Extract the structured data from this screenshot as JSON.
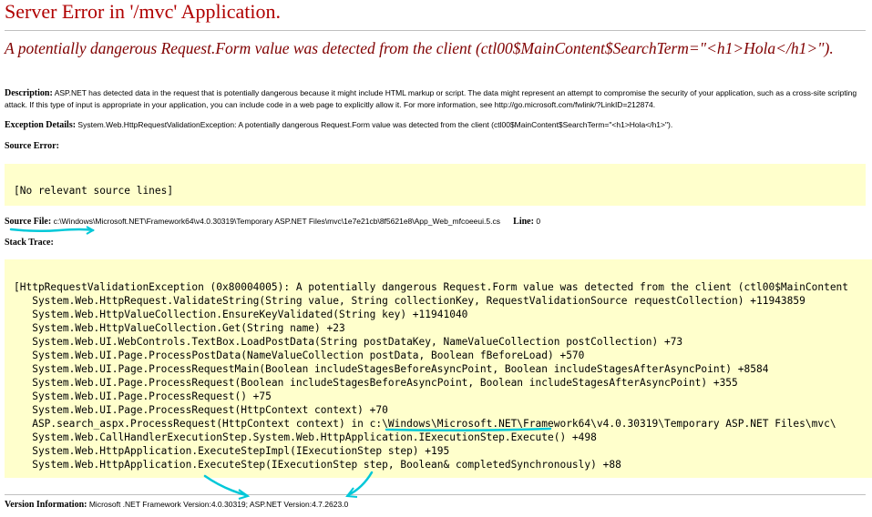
{
  "page": {
    "title": "Server Error in '/mvc' Application.",
    "message": "A potentially dangerous Request.Form value was detected from the client (ctl00$MainContent$SearchTerm=\"<h1>Hola</h1>\").",
    "description": {
      "label": "Description:",
      "text": "ASP.NET has detected data in the request that is potentially dangerous because it might include HTML markup or script. The data might represent an attempt to compromise the security of your application, such as a cross-site scripting attack. If this type of input is appropriate in your application, you can include code in a web page to explicitly allow it. For more information, see http://go.microsoft.com/fwlink/?LinkID=212874."
    },
    "exception": {
      "label": "Exception Details:",
      "text": "System.Web.HttpRequestValidationException: A potentially dangerous Request.Form value was detected from the client (ctl00$MainContent$SearchTerm=\"<h1>Hola</h1>\")."
    },
    "source_error": {
      "label": "Source Error:",
      "text": "[No relevant source lines]"
    },
    "source_file": {
      "label": "Source File:",
      "path": "c:\\Windows\\Microsoft.NET\\Framework64\\v4.0.30319\\Temporary ASP.NET Files\\mvc\\1e7e21cb\\8f5621e8\\App_Web_mfcoeeui.5.cs",
      "line_label": "Line:",
      "line_value": "0"
    },
    "stack_trace": {
      "label": "Stack Trace:",
      "lines": [
        "[HttpRequestValidationException (0x80004005): A potentially dangerous Request.Form value was detected from the client (ctl00$MainContent",
        "   System.Web.HttpRequest.ValidateString(String value, String collectionKey, RequestValidationSource requestCollection) +11943859",
        "   System.Web.HttpValueCollection.EnsureKeyValidated(String key) +11941040",
        "   System.Web.HttpValueCollection.Get(String name) +23",
        "   System.Web.UI.WebControls.TextBox.LoadPostData(String postDataKey, NameValueCollection postCollection) +73",
        "   System.Web.UI.Page.ProcessPostData(NameValueCollection postData, Boolean fBeforeLoad) +570",
        "   System.Web.UI.Page.ProcessRequestMain(Boolean includeStagesBeforeAsyncPoint, Boolean includeStagesAfterAsyncPoint) +8584",
        "   System.Web.UI.Page.ProcessRequest(Boolean includeStagesBeforeAsyncPoint, Boolean includeStagesAfterAsyncPoint) +355",
        "   System.Web.UI.Page.ProcessRequest() +75",
        "   System.Web.UI.Page.ProcessRequest(HttpContext context) +70",
        "   ASP.search_aspx.ProcessRequest(HttpContext context) in c:\\Windows\\Microsoft.NET\\Framework64\\v4.0.30319\\Temporary ASP.NET Files\\mvc\\",
        "   System.Web.CallHandlerExecutionStep.System.Web.HttpApplication.IExecutionStep.Execute() +498",
        "   System.Web.HttpApplication.ExecuteStepImpl(IExecutionStep step) +195",
        "   System.Web.HttpApplication.ExecuteStep(IExecutionStep step, Boolean& completedSynchronously) +88"
      ]
    },
    "version": {
      "label": "Version Information:",
      "text": "Microsoft .NET Framework Version:4.0.30319; ASP.NET Version:4.7.2623.0"
    }
  },
  "colors": {
    "title": "#b00000",
    "message": "#800000",
    "code_background": "#ffffcc",
    "annotation": "#00c8d8"
  }
}
